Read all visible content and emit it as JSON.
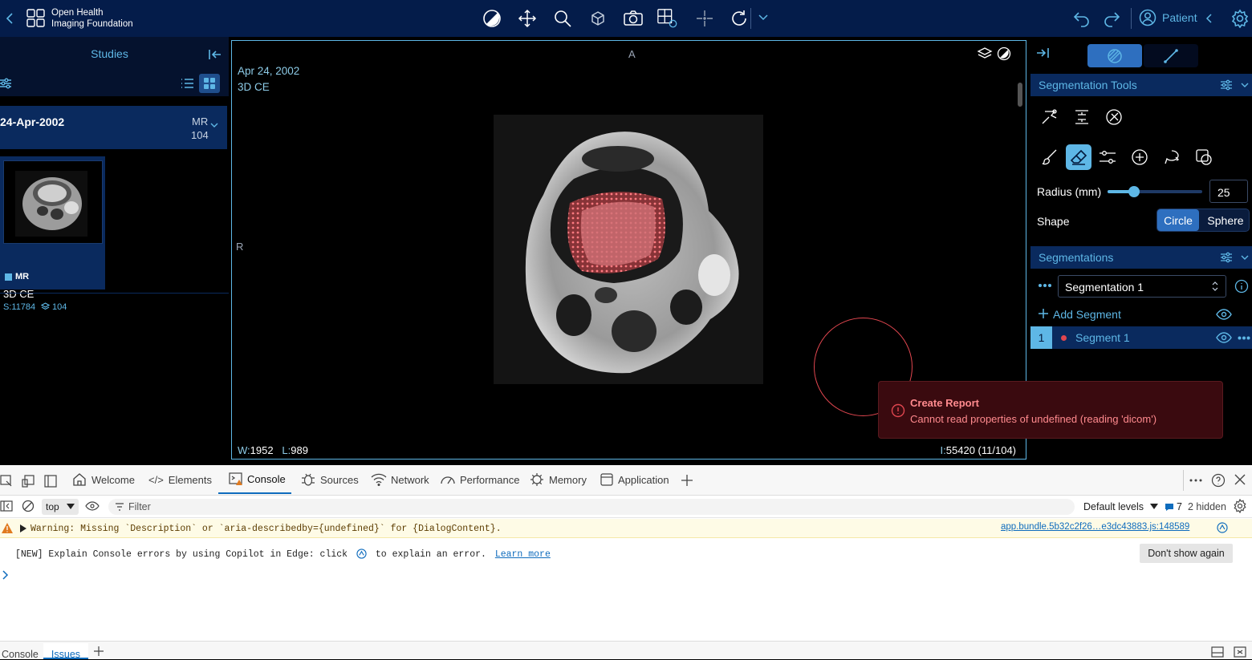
{
  "app": {
    "logo_line1": "Open Health",
    "logo_line2": "Imaging Foundation",
    "patient_label": "Patient"
  },
  "toolbar": {
    "icons": [
      "contrast-icon",
      "move-icon",
      "zoom-icon",
      "rotate-3d-icon",
      "camera-icon",
      "layout-icon",
      "crosshair-icon",
      "reset-rotate-icon"
    ]
  },
  "left_panel": {
    "title": "Studies",
    "study": {
      "date": "24-Apr-2002",
      "modality": "MR",
      "count": "104"
    },
    "series": {
      "modality": "MR",
      "description": "3D CE",
      "series_number": "S:11784",
      "instances": "104"
    }
  },
  "viewport": {
    "orientation_top": "A",
    "orientation_left": "R",
    "date": "Apr 24, 2002",
    "description": "3D CE",
    "window_label": "W:",
    "window_value": "1952",
    "level_label": "L:",
    "level_value": "989",
    "instance_label": "I:",
    "instance_value": "55420 (11/104)"
  },
  "right_panel": {
    "seg_tools_title": "Segmentation Tools",
    "radius_label": "Radius (mm)",
    "radius_value": "25",
    "radius_fraction": 0.28,
    "shape_label": "Shape",
    "shape_options": [
      "Circle",
      "Sphere"
    ],
    "shape_selected": "Circle",
    "segmentations_title": "Segmentations",
    "segmentation_selected": "Segmentation 1",
    "add_segment": "Add Segment",
    "segment": {
      "index": "1",
      "name": "Segment 1",
      "color": "#e0464f"
    }
  },
  "toast": {
    "title": "Create Report",
    "message": "Cannot read properties of undefined (reading 'dicom')"
  },
  "devtools": {
    "tabs": [
      "Welcome",
      "Elements",
      "Console",
      "Sources",
      "Network",
      "Performance",
      "Memory",
      "Application"
    ],
    "active_tab": "Console",
    "context": "top",
    "filter_placeholder": "Filter",
    "levels": "Default levels",
    "issues_count": "7",
    "hidden": "2 hidden",
    "warning_text": "Warning: Missing `Description` or `aria-describedby={undefined}` for {DialogContent}.",
    "warning_source": "app.bundle.5b32c2f26…e3dc43883.js:148589",
    "info_text_1": "[NEW] Explain Console errors by using Copilot in Edge: click",
    "info_text_2": "to explain an error.",
    "learn_more": "Learn more",
    "dont_show": "Don't show again",
    "drawer_tabs": [
      "Console",
      "Issues"
    ],
    "drawer_active": "Issues"
  },
  "colors": {
    "topbar": "#041c4a",
    "accent": "#5eb7e6",
    "active_button": "#3f8bc9",
    "toast_bg": "#3a0a0f"
  }
}
